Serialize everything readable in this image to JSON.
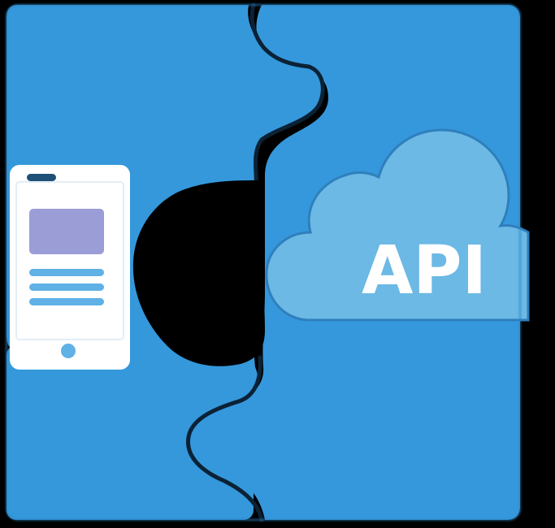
{
  "graphic": {
    "cloud_label": "API",
    "icons": {
      "left_piece": "puzzle-piece-icon",
      "right_piece": "puzzle-piece-icon",
      "phone": "smartphone-icon",
      "cloud": "cloud-icon"
    },
    "colors": {
      "background": "#000000",
      "puzzle_blue": "#3498db",
      "seam": "#0b2236",
      "phone_body": "#ffffff",
      "phone_screen_block": "#9a9dd6",
      "phone_lines": "#5fb1e6",
      "cloud_fill": "#6bb9e4",
      "cloud_outline": "#2f7fbd",
      "label_text": "#ffffff"
    }
  }
}
